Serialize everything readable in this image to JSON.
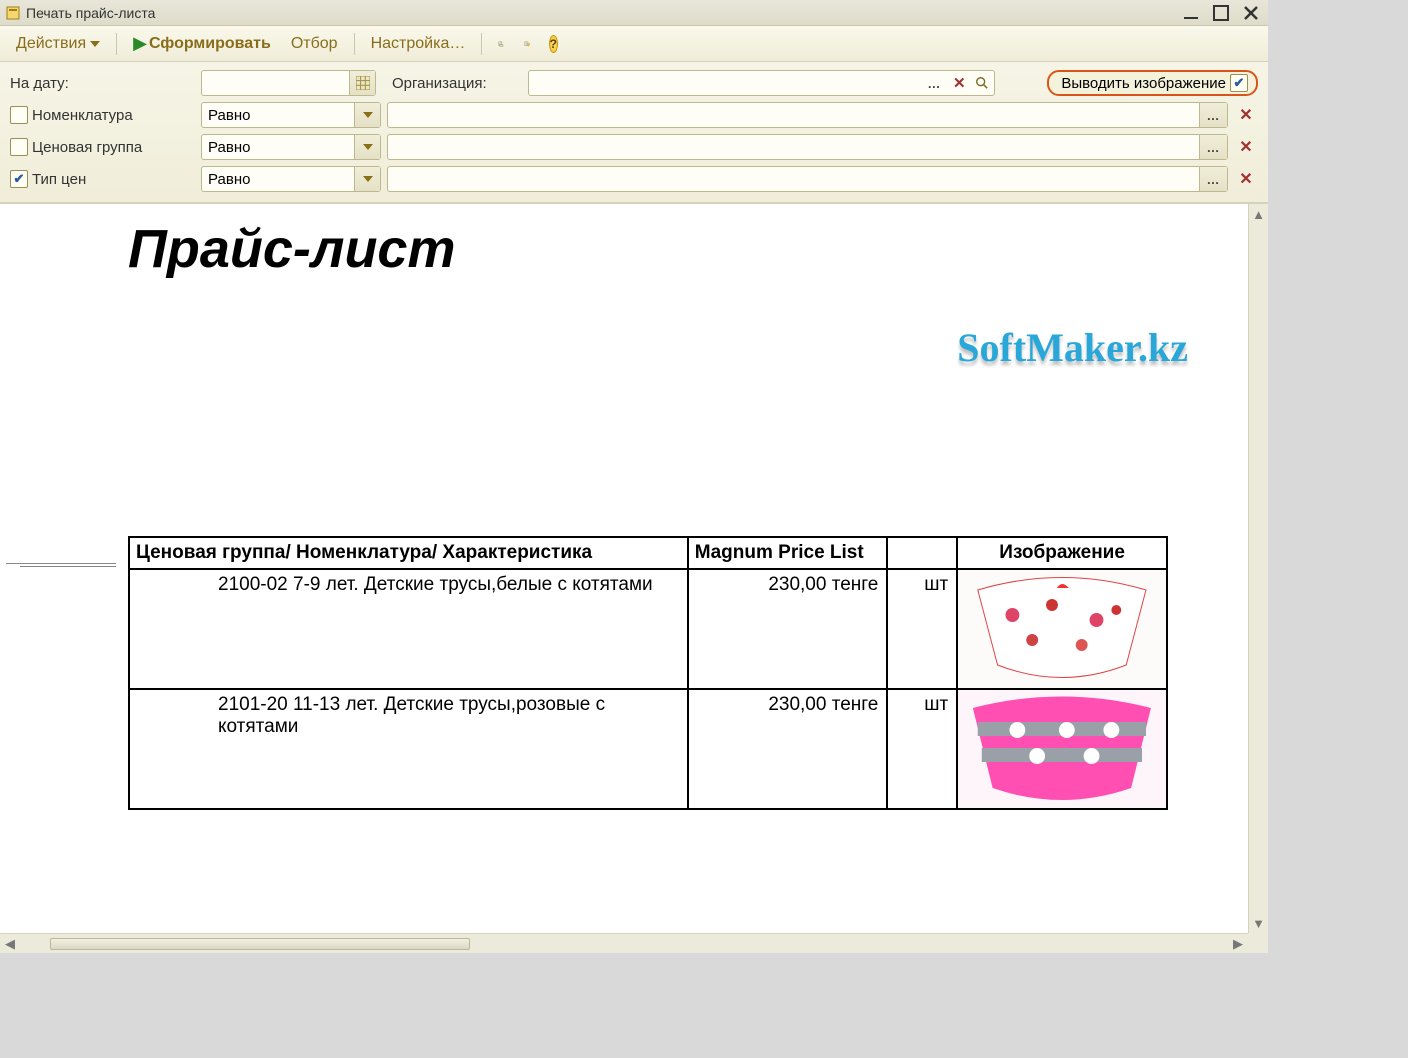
{
  "window": {
    "title": "Печать прайс-листа"
  },
  "toolbar": {
    "actions_label": "Действия",
    "form_label": "Сформировать",
    "filter_label": "Отбор",
    "settings_label": "Настройка…"
  },
  "filters": {
    "date_label": "На дату:",
    "org_label": "Организация:",
    "show_image_label": "Выводить изображение",
    "show_image_checked": true,
    "rows": [
      {
        "label": "Номенклатура",
        "checked": false,
        "op": "Равно"
      },
      {
        "label": "Ценовая группа",
        "checked": false,
        "op": "Равно"
      },
      {
        "label": "Тип цен",
        "checked": true,
        "op": "Равно"
      }
    ]
  },
  "report": {
    "title": "Прайс-лист",
    "watermark": "SoftMaker.kz",
    "headers": {
      "name": "Ценовая группа/ Номенклатура/ Характеристика",
      "price": "Magnum Price List",
      "image": "Изображение"
    },
    "rows": [
      {
        "name": "2100-02 7-9 лет. Детские трусы,белые с котятами",
        "price": "230,00 тенге",
        "unit": "шт"
      },
      {
        "name": "2101-20 11-13 лет. Детские трусы,розовые с котятами",
        "price": "230,00 тенге",
        "unit": "шт"
      }
    ]
  }
}
